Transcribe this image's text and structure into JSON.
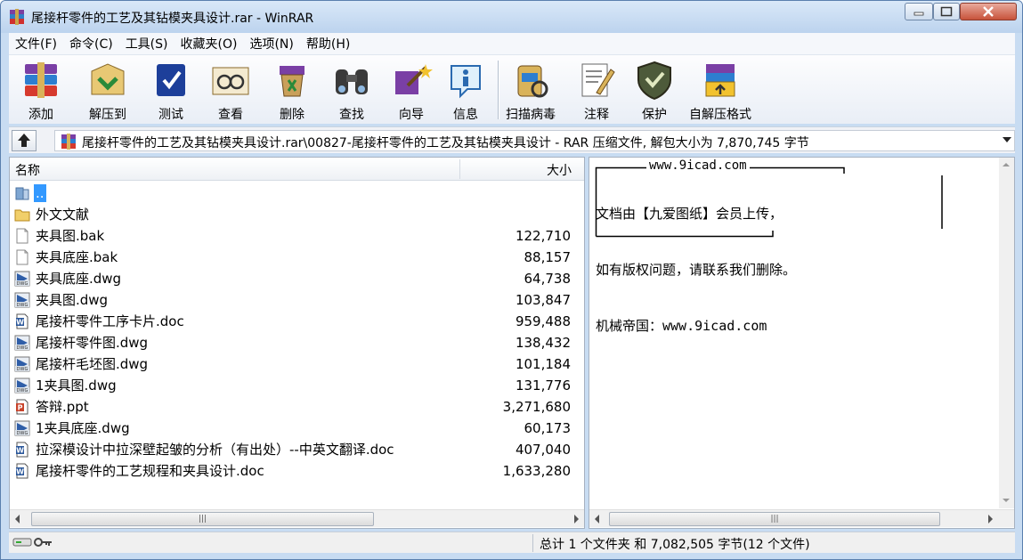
{
  "window": {
    "title": "尾接杆零件的工艺及其钻模夹具设计.rar - WinRAR"
  },
  "menu": [
    "文件(F)",
    "命令(C)",
    "工具(S)",
    "收藏夹(O)",
    "选项(N)",
    "帮助(H)"
  ],
  "toolbar": [
    {
      "label": "添加",
      "icon": "add-archive-icon"
    },
    {
      "label": "解压到",
      "icon": "extract-to-icon"
    },
    {
      "label": "测试",
      "icon": "test-icon"
    },
    {
      "label": "查看",
      "icon": "view-icon"
    },
    {
      "label": "删除",
      "icon": "delete-icon"
    },
    {
      "label": "查找",
      "icon": "find-icon"
    },
    {
      "label": "向导",
      "icon": "wizard-icon"
    },
    {
      "label": "信息",
      "icon": "info-icon"
    },
    {
      "label": "扫描病毒",
      "icon": "virus-scan-icon"
    },
    {
      "label": "注释",
      "icon": "comment-icon"
    },
    {
      "label": "保护",
      "icon": "protect-icon"
    },
    {
      "label": "自解压格式",
      "icon": "sfx-icon"
    }
  ],
  "address": {
    "path": "尾接杆零件的工艺及其钻模夹具设计.rar\\00827-尾接杆零件的工艺及其钻模夹具设计 - RAR 压缩文件, 解包大小为 7,870,745 字节"
  },
  "list": {
    "headers": {
      "name": "名称",
      "size": "大小"
    },
    "rows": [
      {
        "name": "..",
        "size": "",
        "type": "up",
        "selected": true
      },
      {
        "name": "外文文献",
        "size": "",
        "type": "folder"
      },
      {
        "name": "夹具图.bak",
        "size": "122,710",
        "type": "file"
      },
      {
        "name": "夹具底座.bak",
        "size": "88,157",
        "type": "file"
      },
      {
        "name": "夹具底座.dwg",
        "size": "64,738",
        "type": "dwg"
      },
      {
        "name": "夹具图.dwg",
        "size": "103,847",
        "type": "dwg"
      },
      {
        "name": "尾接杆零件工序卡片.doc",
        "size": "959,488",
        "type": "doc"
      },
      {
        "name": "尾接杆零件图.dwg",
        "size": "138,432",
        "type": "dwg"
      },
      {
        "name": "尾接杆毛坯图.dwg",
        "size": "101,184",
        "type": "dwg"
      },
      {
        "name": "1夹具图.dwg",
        "size": "131,776",
        "type": "dwg"
      },
      {
        "name": "答辩.ppt",
        "size": "3,271,680",
        "type": "ppt"
      },
      {
        "name": "1夹具底座.dwg",
        "size": "60,173",
        "type": "dwg"
      },
      {
        "name": "拉深模设计中拉深壁起皱的分析（有出处）--中英文翻译.doc",
        "size": "407,040",
        "type": "doc"
      },
      {
        "name": "尾接杆零件的工艺规程和夹具设计.doc",
        "size": "1,633,280",
        "type": "doc"
      }
    ]
  },
  "comment": {
    "header": "www.9icad.com",
    "lines": [
      "文档由【九爱图纸】会员上传，",
      "如有版权问题，请联系我们删除。",
      "机械帝国：www.9icad.com"
    ]
  },
  "status": {
    "text": "总计 1 个文件夹 和 7,082,505 字节(12 个文件)"
  },
  "colors": {
    "selection": "#3399ff",
    "titlebar": "#c8dcf2"
  }
}
